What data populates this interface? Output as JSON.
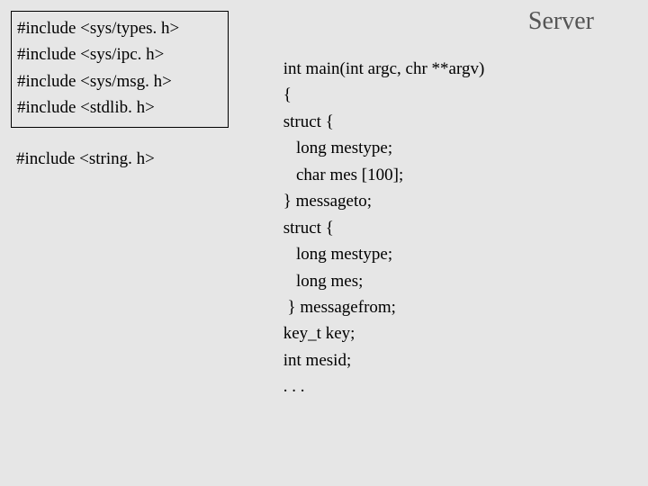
{
  "title": "Server",
  "includes": {
    "l1": "#include <sys/types. h>",
    "l2": "#include <sys/ipc. h>",
    "l3": "#include <sys/msg. h>",
    "l4": "#include <stdlib. h>",
    "extra": "#include <string. h>"
  },
  "code": " int main(int argc, chr **argv)\n {\n struct {\n    long mestype;\n    char mes [100];\n } messageto;\n struct {\n    long mestype;\n    long mes;\n  } messagefrom;\n key_t key;\n int mesid;\n . . ."
}
